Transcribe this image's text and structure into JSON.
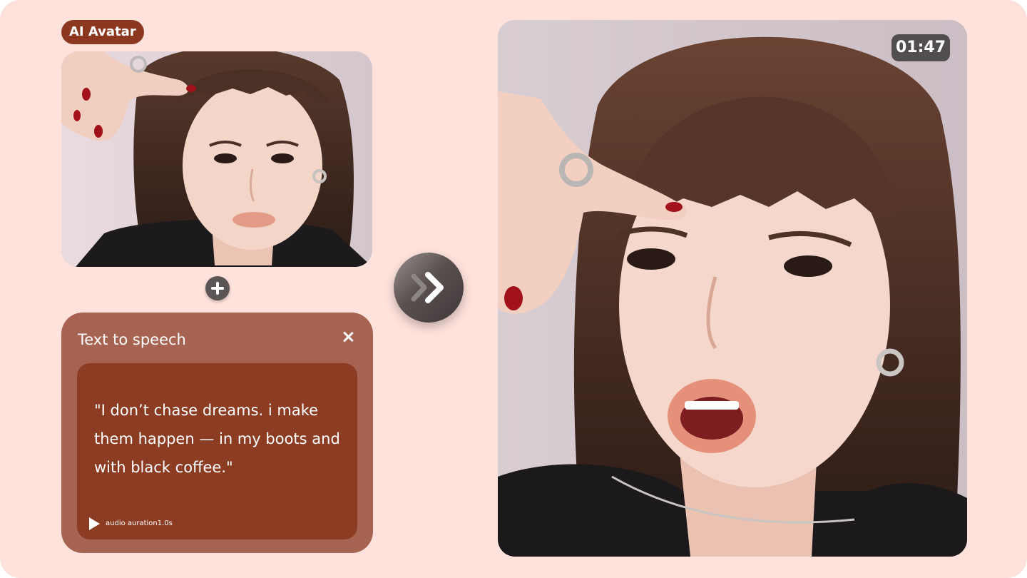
{
  "badge": {
    "label": "AI Avatar"
  },
  "source_photo": {
    "kind": "portrait photo"
  },
  "tts": {
    "title": "Text to speech",
    "quote": "\"I don’t chase dreams. i make them happen — in my boots and with black coffee.\"",
    "audio_label": "audio auration1.0s"
  },
  "result": {
    "timer": "01:47"
  },
  "colors": {
    "background": "#ffe2dc",
    "badge": "#8c3820",
    "panel": "#a66352",
    "card": "#8c3c22"
  },
  "icons": [
    "plus-icon",
    "close-icon",
    "play-icon",
    "double-chevron-right-icon"
  ]
}
